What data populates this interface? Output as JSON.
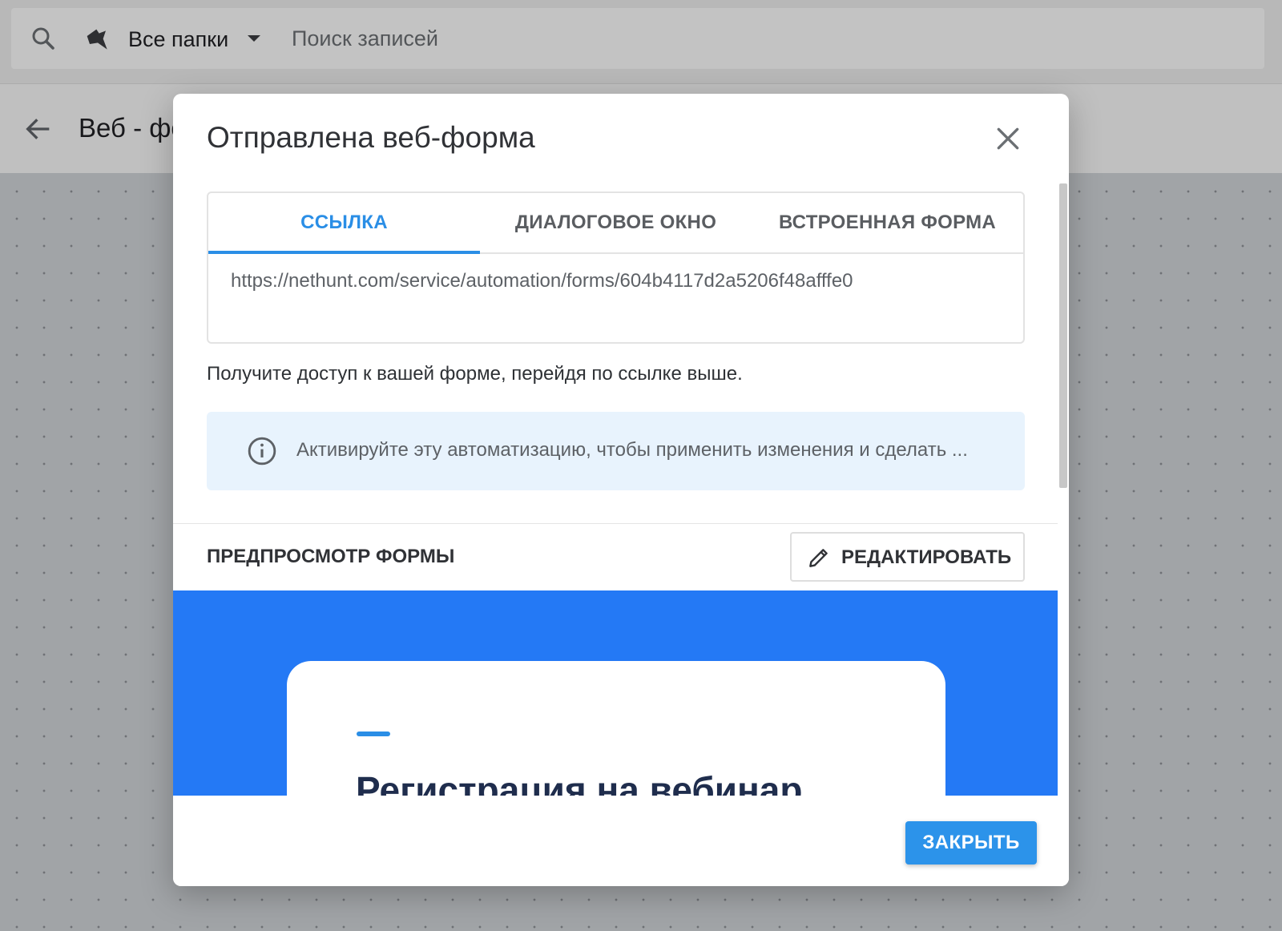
{
  "topbar": {
    "folders_label": "Все папки",
    "search_placeholder": "Поиск записей"
  },
  "page": {
    "title": "Веб - фо"
  },
  "dialog": {
    "title": "Отправлена веб-форма",
    "tabs": [
      {
        "label": "ССЫЛКА",
        "active": true
      },
      {
        "label": "ДИАЛОГОВОЕ ОКНО",
        "active": false
      },
      {
        "label": "ВСТРОЕННАЯ ФОРМА",
        "active": false
      }
    ],
    "link": "https://nethunt.com/service/automation/forms/604b4117d2a5206f48afffe0",
    "help_text": "Получите доступ к вашей форме, перейдя по ссылке выше.",
    "info_text": "Активируйте эту автоматизацию, чтобы применить изменения и сделать ...",
    "preview_label": "ПРЕДПРОСМОТР ФОРМЫ",
    "edit_label": "РЕДАКТИРОВАТЬ",
    "preview_heading": "Регистрация на вебинар",
    "close_label": "ЗАКРЫТЬ"
  },
  "icons": {
    "search": "search-icon",
    "folder": "folder-icon",
    "caret": "caret-down-icon",
    "back": "arrow-left-icon",
    "close": "close-icon",
    "info": "info-icon",
    "pencil": "pencil-icon"
  },
  "colors": {
    "accent": "#2a8ee6",
    "preview_bg": "#2479f5",
    "info_bg": "#e8f3fd",
    "close_button": "#2c93ea"
  }
}
